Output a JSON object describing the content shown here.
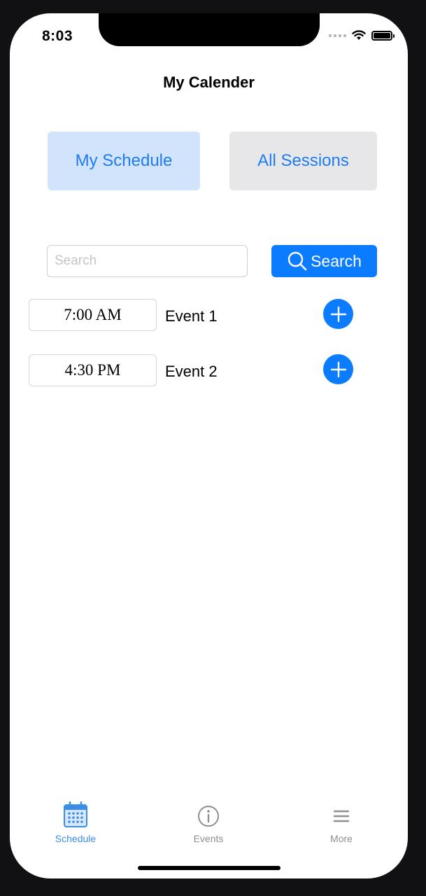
{
  "status_bar": {
    "time": "8:03"
  },
  "nav": {
    "title": "My Calender"
  },
  "segments": {
    "my_schedule": "My Schedule",
    "all_sessions": "All Sessions"
  },
  "search": {
    "placeholder": "Search",
    "value": "",
    "button_label": "Search"
  },
  "events": [
    {
      "time": "7:00 AM",
      "name": "Event 1"
    },
    {
      "time": "4:30 PM",
      "name": "Event 2"
    }
  ],
  "tabbar": {
    "items": [
      {
        "label": "Schedule",
        "icon": "calendar-icon",
        "selected": true
      },
      {
        "label": "Events",
        "icon": "info-icon",
        "selected": false
      },
      {
        "label": "More",
        "icon": "menu-icon",
        "selected": false
      }
    ]
  },
  "colors": {
    "accent": "#0b7bff",
    "selected_tab": "#3b8de8",
    "inactive_tab": "#8e8e93",
    "segment_selected_bg": "#d2e4fb",
    "segment_bg": "#e7e7ea"
  }
}
